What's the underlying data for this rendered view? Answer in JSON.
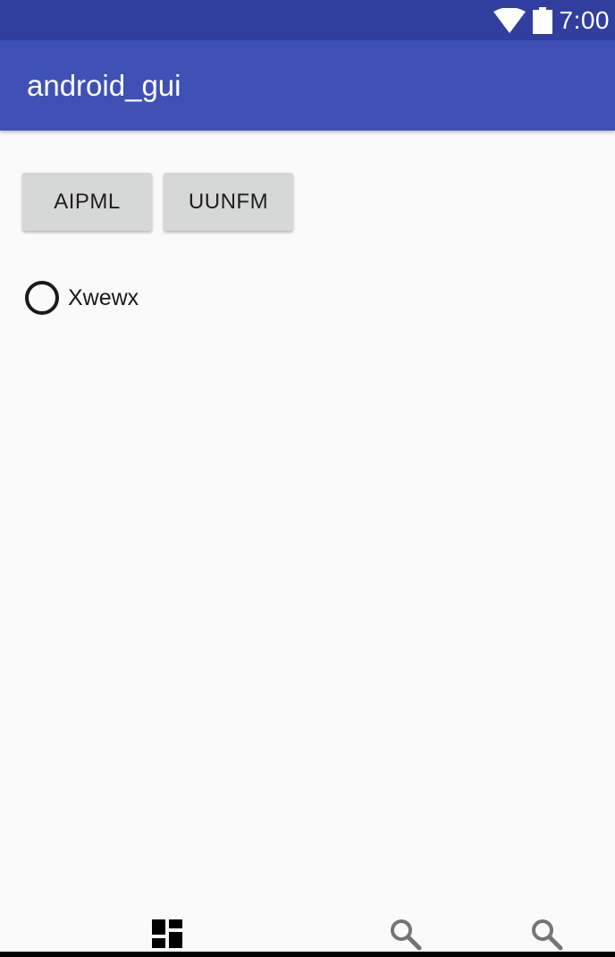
{
  "status_bar": {
    "time": "7:00",
    "icons": [
      "wifi-icon",
      "battery-icon"
    ],
    "color": "#303f9f"
  },
  "app_bar": {
    "title": "android_gui",
    "color": "#3f51b5"
  },
  "buttons": [
    {
      "label": "AIPML"
    },
    {
      "label": "UUNFM"
    }
  ],
  "radio": {
    "label": "Xwewx",
    "checked": false
  },
  "bottom_nav": {
    "items": [
      {
        "icon": "dashboard-icon",
        "active": true
      },
      {
        "icon": "search-icon",
        "active": false
      },
      {
        "icon": "search-icon",
        "active": false
      }
    ]
  }
}
